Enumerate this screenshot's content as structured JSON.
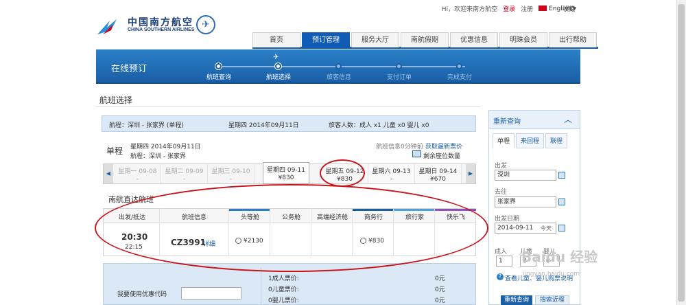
{
  "brand": {
    "name_cn": "中国南方航空",
    "name_en": "CHINA SOUTHERN AIRLINES"
  },
  "toplinks": {
    "welcome": "Hi，欢迎来南方航空",
    "login": "登录",
    "register": "注册",
    "language": "English",
    "favorite": "收藏"
  },
  "nav": [
    "首页",
    "预订管理",
    "服务大厅",
    "南航假期",
    "优惠信息",
    "明珠会员",
    "出行帮助"
  ],
  "banner": {
    "title": "在线预订",
    "steps": [
      "航班查询",
      "航班选择",
      "旅客信息",
      "支付订单",
      "完成支付"
    ],
    "current_step": 2
  },
  "page_title": "航班选择",
  "route_bar": {
    "route": "航程：深圳 - 张家界 (单程)",
    "date": "星期四 2014年09月11日",
    "passengers": "旅客人数：成人 x1 儿童 x0 婴儿 x0"
  },
  "single": {
    "label": "单程",
    "date": "星期四    2014年09月11日",
    "route": "航程：深圳 - 张家界",
    "update_info": "航班信息0分钟前",
    "update_link": "获取最新票价",
    "seats_link": "剩余座位数量"
  },
  "dates": [
    {
      "day": "星期一 09-08",
      "price": "-",
      "state": "past"
    },
    {
      "day": "星期二 09-09",
      "price": "-",
      "state": "past"
    },
    {
      "day": "星期三 09-10",
      "price": "-",
      "state": "past"
    },
    {
      "day": "星期四 09-11",
      "price": "¥830",
      "state": "selected"
    },
    {
      "day": "星期五 09-12",
      "price": "¥830",
      "state": "normal"
    },
    {
      "day": "星期六 09-13",
      "price": "-",
      "state": "normal"
    },
    {
      "day": "星期日 09-14",
      "price": "¥670",
      "state": "normal"
    }
  ],
  "section_title": "南航直达航班",
  "table_headers": [
    "出发/抵达",
    "航班信息",
    "头等舱",
    "公务舱",
    "高端经济舱",
    "商务行",
    "旅行家",
    "快乐飞"
  ],
  "flight": {
    "depart": "20:30",
    "arrive": "22:15",
    "number": "CZ3991",
    "detail": "详细",
    "first": "¥2130",
    "business_travel": "¥830"
  },
  "promo": {
    "label": "我要使用优惠代码"
  },
  "fares": [
    {
      "label": "1成人票价:",
      "value": "0元"
    },
    {
      "label": "0儿童票价:",
      "value": "0元"
    },
    {
      "label": "0婴儿票价:",
      "value": "0元"
    }
  ],
  "search_panel": {
    "title": "重新查询",
    "tabs": [
      "单程",
      "来回程",
      "联程"
    ],
    "from_label": "出发",
    "from": "深圳",
    "to_label": "去往",
    "to": "张家界",
    "date_label": "出发日期",
    "date": "2014-09-11",
    "today": "今天",
    "adult_label": "成人",
    "child_label": "儿童",
    "infant_label": "婴儿",
    "adult": "1",
    "child": "0",
    "infant": "0",
    "help": "查看儿童、婴儿购票说明",
    "search_btn": "重新查询",
    "history_btn": "搜索近程"
  },
  "watermark": {
    "text": "Baidu 经验",
    "url": "jingyan.baidu.com"
  },
  "colors": {
    "brand_blue": "#1a5ea5",
    "annotation_red": "#c8141c"
  }
}
